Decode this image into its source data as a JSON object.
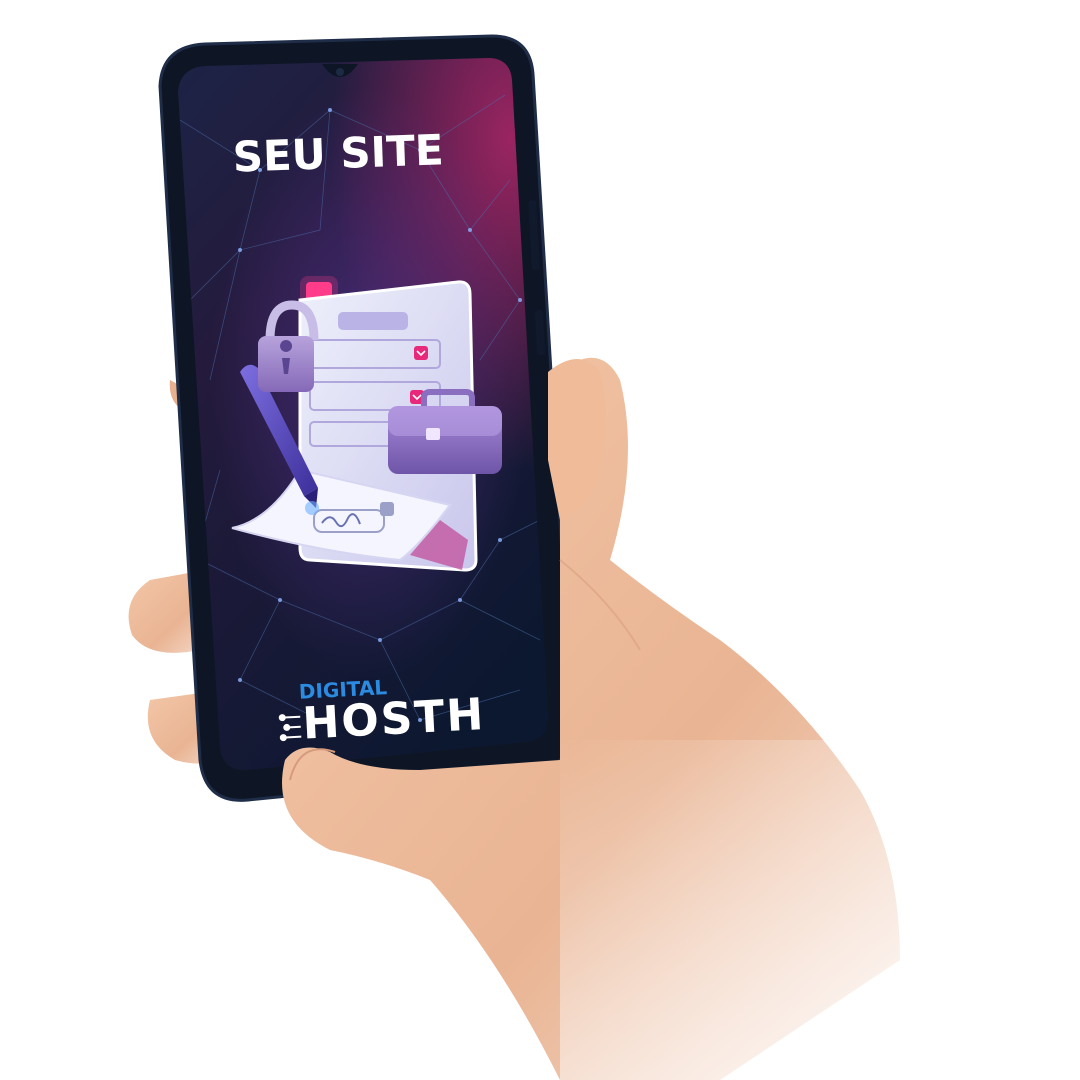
{
  "screen": {
    "headline": "SEU SITE",
    "brand": {
      "top_word": "DIGITAL",
      "main_word": "HOSTH"
    }
  },
  "colors": {
    "screen_top": "#2a1f4a",
    "screen_bottom": "#0d1a33",
    "accent_pink": "#e8287a",
    "accent_purple": "#8a5fc4",
    "brand_blue": "#2a8be0",
    "skin": "#f0c0a0",
    "phone_frame": "#0e1626"
  },
  "icons": [
    "padlock-icon",
    "pen-icon",
    "document-icon",
    "briefcase-icon",
    "signature-icon",
    "circuit-icon"
  ]
}
